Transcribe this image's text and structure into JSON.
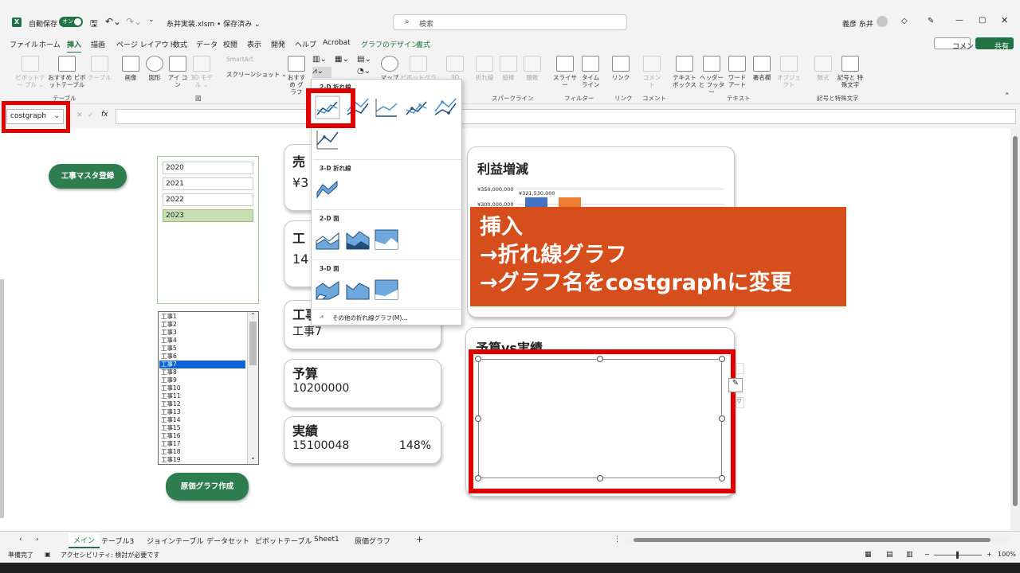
{
  "titlebar": {
    "autosave_label": "自動保存",
    "autosave_toggle": "オン",
    "filename": "糸井実装.xlsm • 保存済み ⌄",
    "search_placeholder": "検索",
    "user_name": "義彦 糸井"
  },
  "menu": [
    "ファイル",
    "ホーム",
    "挿入",
    "描画",
    "ページ レイアウト",
    "数式",
    "データ",
    "校閲",
    "表示",
    "開発",
    "ヘルプ",
    "Acrobat",
    "グラフのデザイン",
    "書式"
  ],
  "menu_right": {
    "comment": "コメント",
    "share": "共有"
  },
  "ribbon": {
    "pivot": "ピボットテー ブル ⌄",
    "rec_pivot": "おすすめ ピボットテーブル",
    "table": "テーブル",
    "image": "画像",
    "shape": "図形",
    "icon": "アイ コン",
    "model3d": "3D モデル ⌄",
    "smartart": "SmartArt",
    "screenshot": "スクリーンショット ⌄",
    "rec_chart": "おすすめ グラフ",
    "map": "マップ",
    "pivot_chart": "ピボットグラフ",
    "d3": "3D",
    "spark_line": "折れ線",
    "spark_col": "縦棒",
    "spark_wl": "勝敗",
    "slicer": "スライサー",
    "timeline": "タイム ライン",
    "link": "リンク",
    "comment": "コメント",
    "textbox": "テキスト ボックス",
    "header": "ヘッダーと フッター",
    "wordart": "ワード アート",
    "signature": "署名欄",
    "object": "オブジェクト",
    "equation": "数式",
    "symbol": "記号と 特殊文字",
    "group_table": "テーブル",
    "group_illust": "図",
    "group_spark": "スパークライン",
    "group_filter": "フィルター",
    "group_link": "リンク",
    "group_comment": "コメント",
    "group_text": "テキスト",
    "group_symbol": "記号と特殊文字"
  },
  "formula_bar": {
    "name_box": "costgraph",
    "fx": "fx",
    "formula": ""
  },
  "sheet": {
    "master_button": "工事マスタ登録",
    "create_button": "原価グラフ作成",
    "years": [
      "2020",
      "2021",
      "2022",
      "2023"
    ],
    "selected_year": "2023",
    "projects": [
      "工事1",
      "工事2",
      "工事3",
      "工事4",
      "工事5",
      "工事6",
      "工事7",
      "工事8",
      "工事9",
      "工事10",
      "工事11",
      "工事12",
      "工事13",
      "工事14",
      "工事15",
      "工事16",
      "工事17",
      "工事18",
      "工事19"
    ],
    "selected_project": "工事7",
    "card_sales_title": "売",
    "card_sales_value": "¥3",
    "card_kouji_title": "工",
    "card_kouji_value": "14",
    "card_name_title": "工事",
    "card_name_value": "工事7",
    "budget_title": "予算",
    "budget_value": "10200000",
    "actual_title": "実績",
    "actual_value": "15100048",
    "actual_pct": "148%",
    "profit_title": "利益増減",
    "profit_tick1": "¥350,000,000",
    "profit_tick2": "¥300,000,000",
    "profit_label": "¥321,530,000",
    "bva_title": "予算vs実績"
  },
  "dropdown": {
    "sec_2d_line": "2-D 折れ線",
    "sec_3d_line": "3-D 折れ線",
    "sec_2d_area": "2-D 面",
    "sec_3d_area": "3-D 面",
    "more": "その他の折れ線グラフ(M)..."
  },
  "callout": {
    "line1": "挿入",
    "line2": "→折れ線グラフ",
    "line3": "→グラフ名をcostgraphに変更"
  },
  "sheet_tabs": [
    "メイン",
    "テーブル3",
    "ジョインテーブル",
    "データセット",
    "ピボットテーブル",
    "Sheet1",
    "原価グラフ"
  ],
  "status": {
    "ready": "準備完了",
    "accessibility": "アクセシビリティ: 検討が必要です",
    "zoom": "100%"
  },
  "colors": {
    "excel_green": "#217346",
    "button_green": "#2e7d4f",
    "highlight_red": "#e00000",
    "callout_orange": "#d54e1c",
    "list_select": "#0a64d8"
  }
}
